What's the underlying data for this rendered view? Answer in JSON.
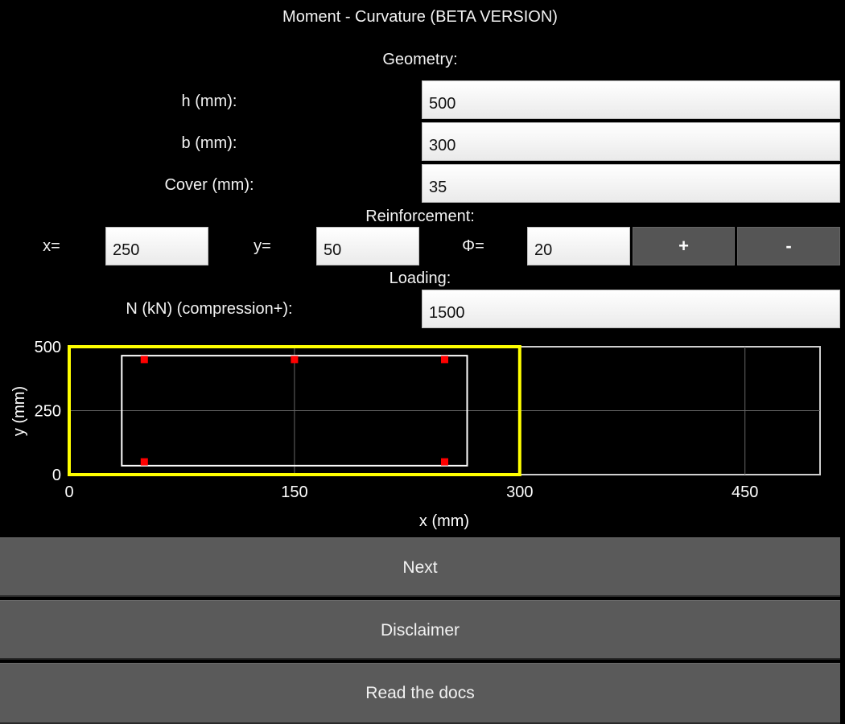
{
  "app": {
    "title": "Moment - Curvature (BETA VERSION)"
  },
  "geometry": {
    "section_title": "Geometry:",
    "h_label": "h (mm):",
    "h_value": "500",
    "b_label": "b (mm):",
    "b_value": "300",
    "cover_label": "Cover (mm):",
    "cover_value": "35"
  },
  "reinforcement": {
    "section_title": "Reinforcement:",
    "x_label": "x=",
    "x_value": "250",
    "y_label": "y=",
    "y_value": "50",
    "phi_label": "Φ=",
    "phi_value": "20",
    "add_label": "+",
    "remove_label": "-"
  },
  "loading": {
    "section_title": "Loading:",
    "n_label": "N (kN) (compression+):",
    "n_value": "1500"
  },
  "colors": {
    "section_outline": "#ffff00",
    "cover_outline": "#ffffff",
    "rebar": "#ff0000",
    "grid": "#666666",
    "button_bg": "#5a5a5a"
  },
  "chart_data": {
    "type": "scatter",
    "xlabel": "x (mm)",
    "ylabel": "y (mm)",
    "xlim": [
      0,
      500
    ],
    "ylim": [
      0,
      500
    ],
    "x_ticks": [
      0,
      150,
      300,
      450
    ],
    "y_ticks": [
      0,
      250,
      500
    ],
    "grid": true,
    "section": {
      "b": 300,
      "h": 500,
      "cover": 35
    },
    "rebars": [
      {
        "x": 50,
        "y": 450
      },
      {
        "x": 150,
        "y": 450
      },
      {
        "x": 250,
        "y": 450
      },
      {
        "x": 50,
        "y": 50
      },
      {
        "x": 250,
        "y": 50
      }
    ]
  },
  "buttons": {
    "next": "Next",
    "disclaimer": "Disclaimer",
    "docs": "Read the docs"
  }
}
